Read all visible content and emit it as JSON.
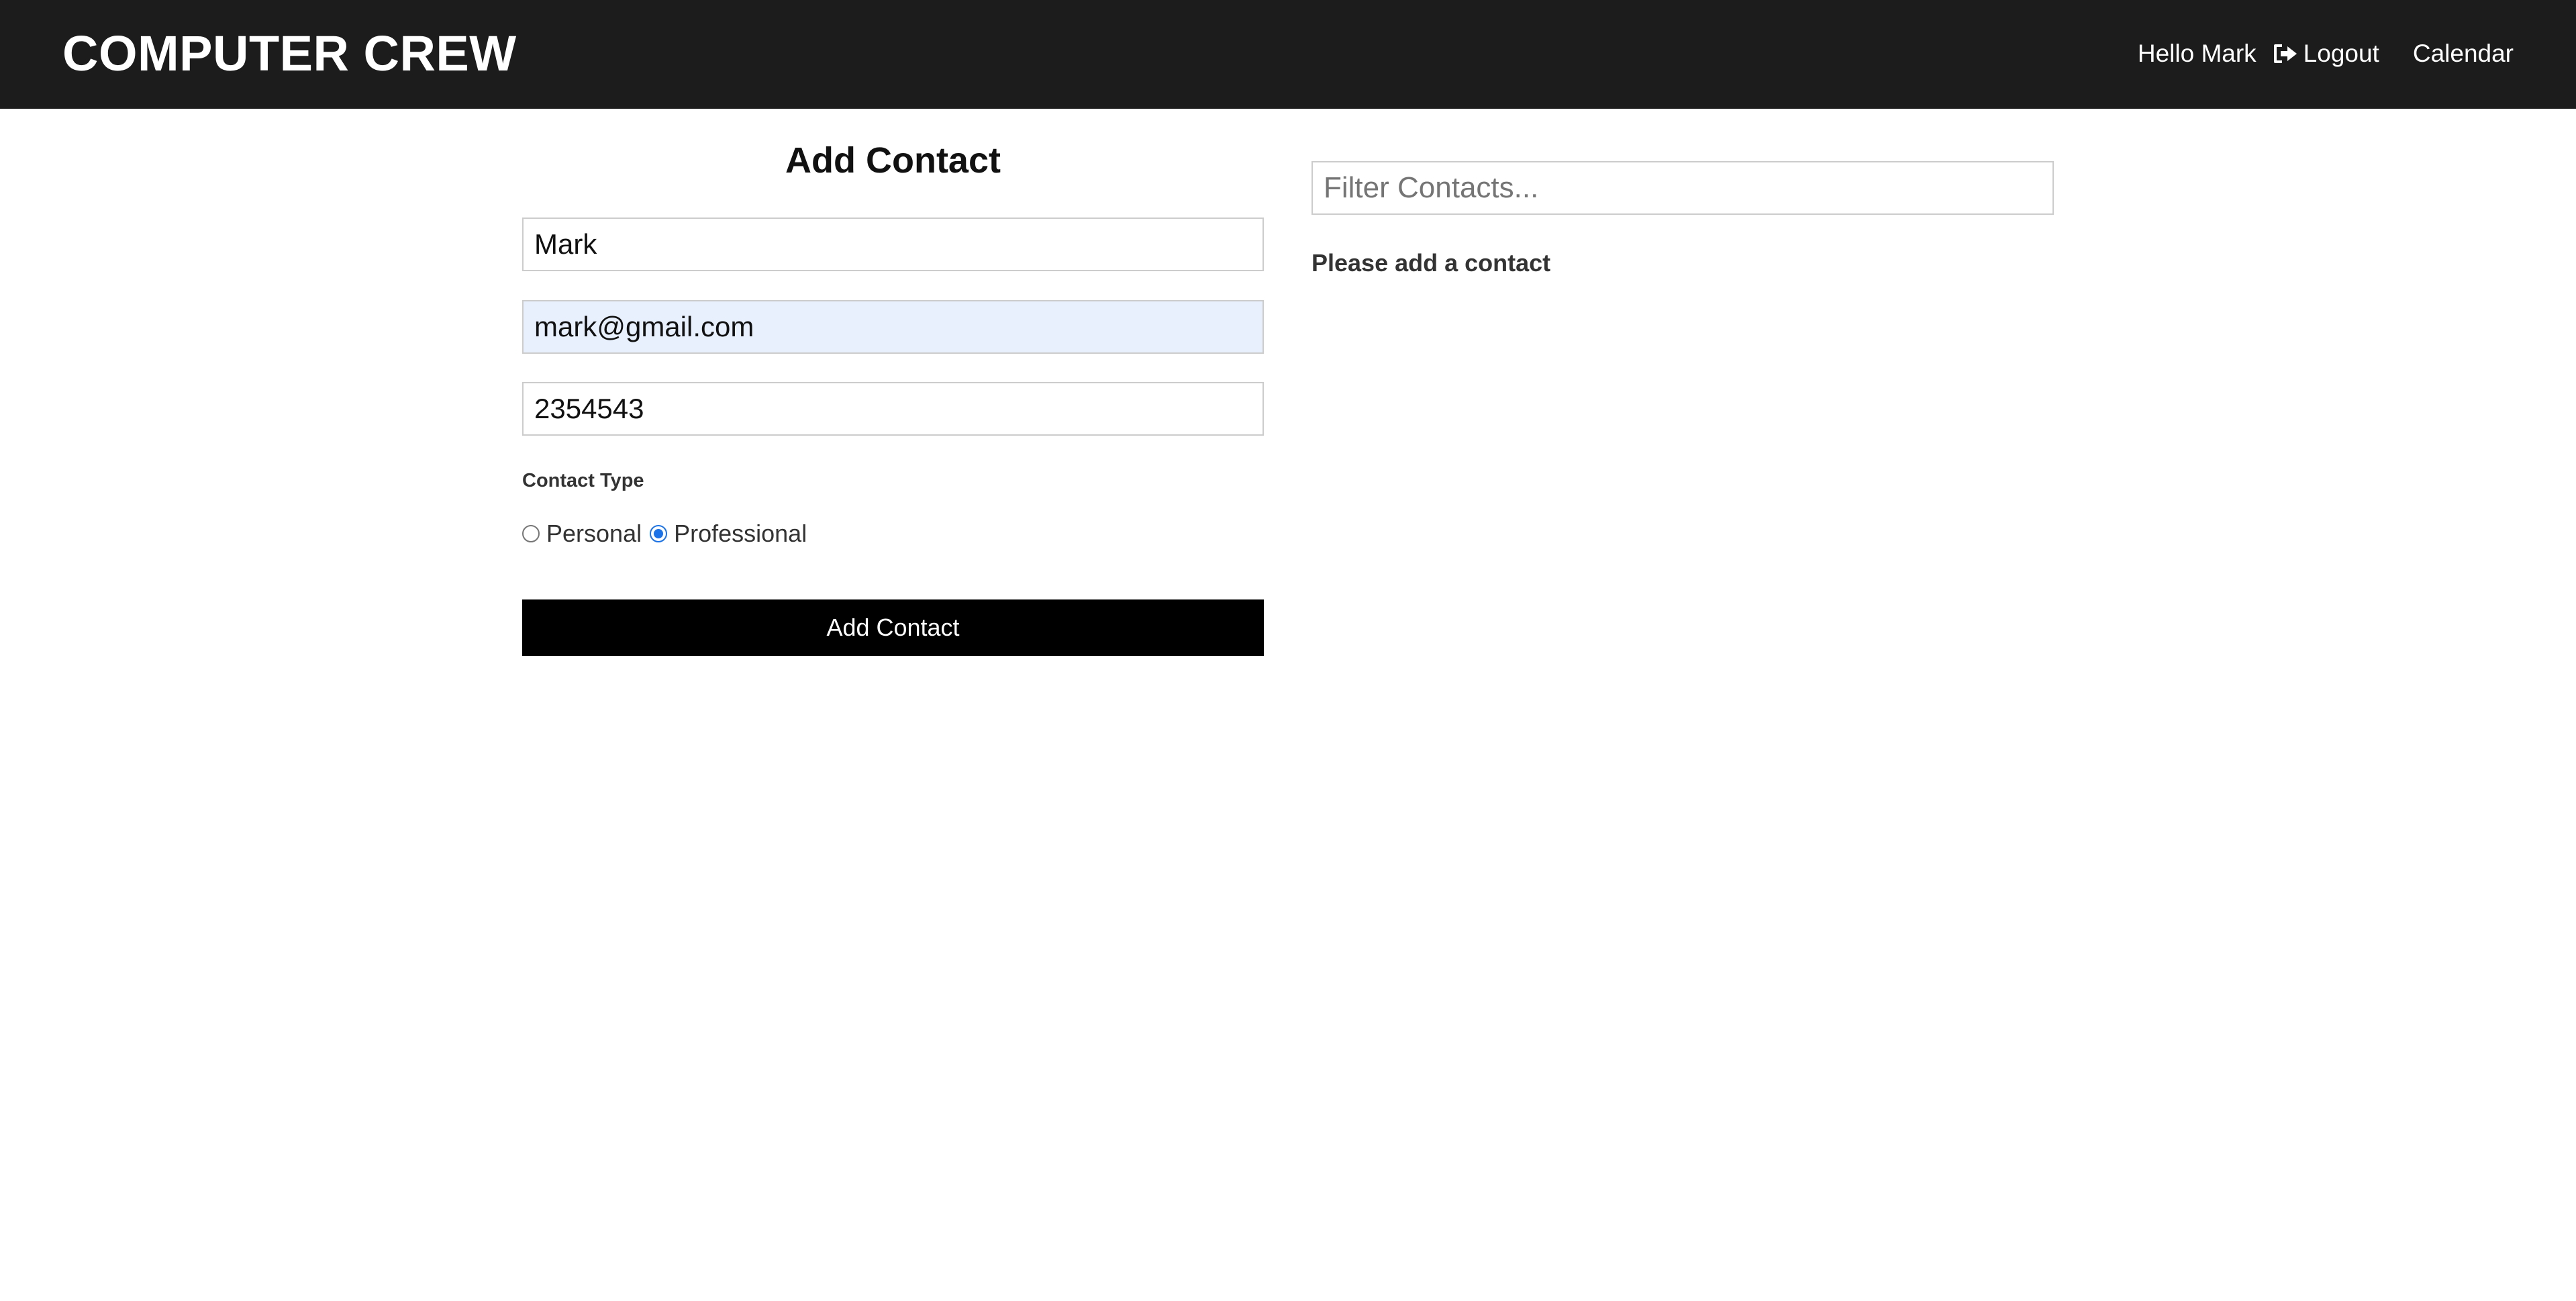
{
  "navbar": {
    "brand": "COMPUTER CREW",
    "greeting": "Hello Mark",
    "logout_label": "Logout",
    "logout_icon": "sign-out-icon",
    "calendar_label": "Calendar"
  },
  "contact_form": {
    "title": "Add Contact",
    "name_value": "Mark",
    "email_value": "mark@gmail.com",
    "phone_value": "2354543",
    "type_heading": "Contact Type",
    "type_options": [
      {
        "label": "Personal",
        "checked": false
      },
      {
        "label": "Professional",
        "checked": true
      }
    ],
    "submit_label": "Add Contact"
  },
  "contacts": {
    "filter_placeholder": "Filter Contacts...",
    "empty_message": "Please add a contact"
  },
  "colors": {
    "navbar_bg": "#1c1c1c",
    "button_bg": "#000000",
    "autofill_bg": "#e8f0fe",
    "radio_accent": "#1a73e8"
  }
}
